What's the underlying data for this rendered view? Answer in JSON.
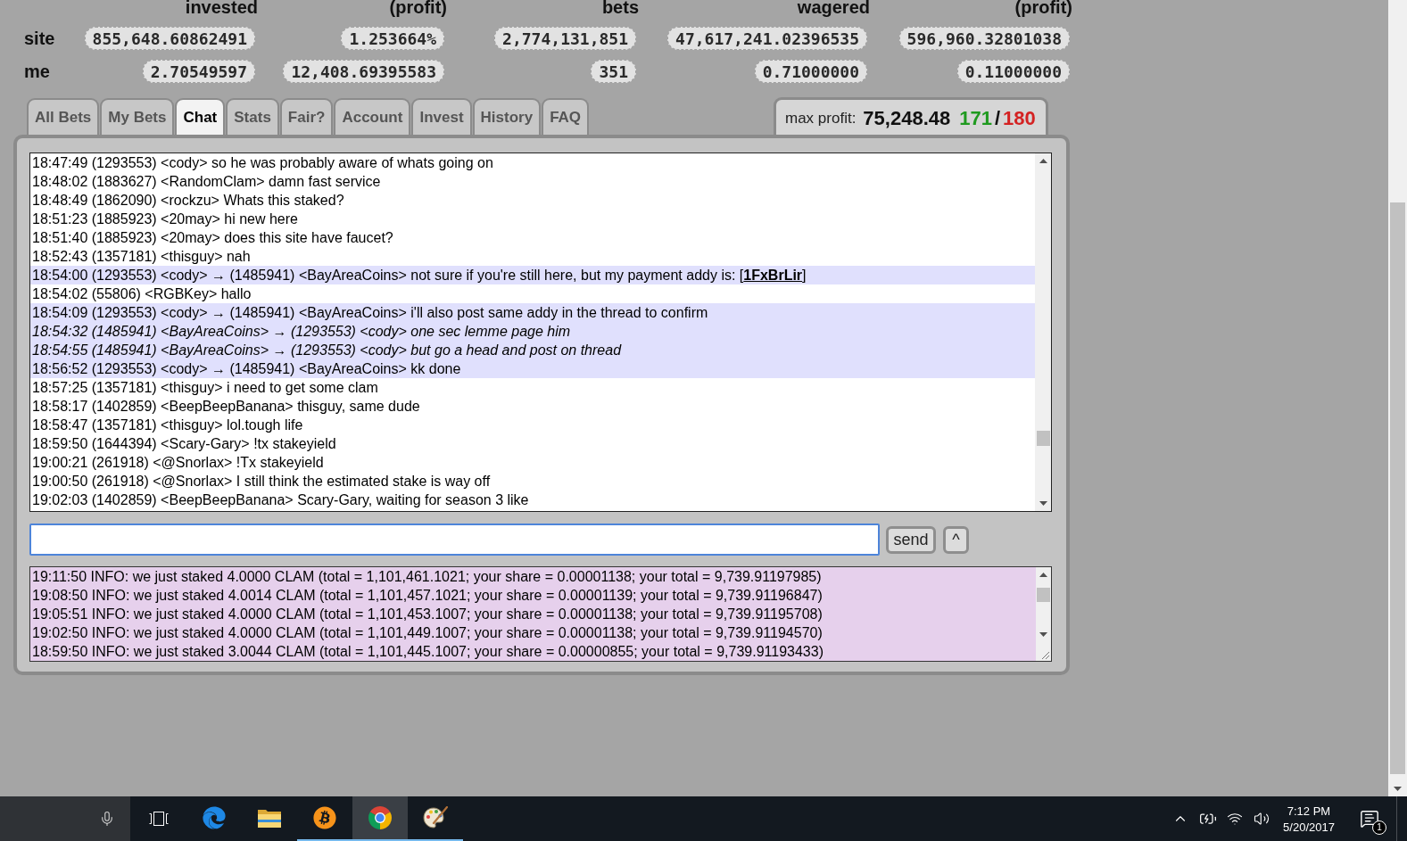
{
  "stats": {
    "columns": [
      "invested",
      "(profit)",
      "bets",
      "wagered",
      "(profit)"
    ],
    "rows": [
      {
        "label": "site",
        "values": [
          "855,648.60862491",
          "1.253664%",
          "2,774,131,851",
          "47,617,241.02396535",
          "596,960.32801038"
        ]
      },
      {
        "label": "me",
        "values": [
          "2.70549597",
          "12,408.69395583",
          "351",
          "0.71000000",
          "0.11000000"
        ]
      }
    ]
  },
  "tabs": [
    {
      "label": "All Bets",
      "selected": false
    },
    {
      "label": "My Bets",
      "selected": false
    },
    {
      "label": "Chat",
      "selected": true
    },
    {
      "label": "Stats",
      "selected": false
    },
    {
      "label": "Fair?",
      "selected": false
    },
    {
      "label": "Account",
      "selected": false
    },
    {
      "label": "Invest",
      "selected": false
    },
    {
      "label": "History",
      "selected": false
    },
    {
      "label": "FAQ",
      "selected": false
    }
  ],
  "max_profit": {
    "label": "max profit:",
    "value": "75,248.48",
    "counts": [
      {
        "value": "171",
        "color": "#1f9a1f"
      },
      {
        "value": "180",
        "color": "#d42222"
      }
    ],
    "separator": "/"
  },
  "chat": {
    "messages": [
      {
        "kind": "public",
        "text": "18:47:49 (1293553) <cody> so he was probably aware of whats going on"
      },
      {
        "kind": "public",
        "text": "18:48:02 (1883627) <RandomClam> damn fast service"
      },
      {
        "kind": "public",
        "text": "18:48:49 (1862090) <rockzu> Whats this staked?"
      },
      {
        "kind": "public",
        "text": "18:51:23 (1885923) <20may> hi new here"
      },
      {
        "kind": "public",
        "text": "18:51:40 (1885923) <20may> does this site have faucet?"
      },
      {
        "kind": "public",
        "text": "18:52:43 (1357181) <thisguy> nah"
      },
      {
        "kind": "private_sent",
        "text": "18:54:00 (1293553) <cody> → (1485941) <BayAreaCoins> not sure if you're still here, but my payment addy is: [",
        "link": "1FxBrLir",
        "text_after": "]"
      },
      {
        "kind": "public",
        "text": "18:54:02 (55806) <RGBKey> hallo"
      },
      {
        "kind": "private_sent",
        "text": "18:54:09 (1293553) <cody> → (1485941) <BayAreaCoins> i'll also post same addy in the thread to confirm"
      },
      {
        "kind": "private_received",
        "text": "18:54:32 (1485941) <BayAreaCoins> → (1293553) <cody> one sec lemme page him"
      },
      {
        "kind": "private_received",
        "text": "18:54:55 (1485941) <BayAreaCoins> → (1293553) <cody> but go a head and post on thread"
      },
      {
        "kind": "private_sent",
        "text": "18:56:52 (1293553) <cody> → (1485941) <BayAreaCoins> kk done"
      },
      {
        "kind": "public",
        "text": "18:57:25 (1357181) <thisguy> i need to get some clam"
      },
      {
        "kind": "public",
        "text": "18:58:17 (1402859) <BeepBeepBanana> thisguy, same dude"
      },
      {
        "kind": "public",
        "text": "18:58:47 (1357181) <thisguy> lol.tough life"
      },
      {
        "kind": "public",
        "text": "18:59:50 (1644394) <Scary-Gary> !tx stakeyield"
      },
      {
        "kind": "public",
        "text": "19:00:21 (261918) <@Snorlax> !Tx stakeyield"
      },
      {
        "kind": "public",
        "text": "19:00:50 (261918) <@Snorlax> I still think the estimated stake is way off"
      },
      {
        "kind": "public",
        "text": "19:02:03 (1402859) <BeepBeepBanana> Scary-Gary, waiting for season 3 like"
      }
    ],
    "input": {
      "focused": true
    },
    "buttons": [
      "send",
      "^"
    ]
  },
  "info_log": {
    "lines": [
      "19:11:50 INFO: we just staked 4.0000 CLAM (total = 1,101,461.1021; your share = 0.00001138; your total = 9,739.91197985)",
      "19:08:50 INFO: we just staked 4.0014 CLAM (total = 1,101,457.1021; your share = 0.00001139; your total = 9,739.91196847)",
      "19:05:51 INFO: we just staked 4.0000 CLAM (total = 1,101,453.1007; your share = 0.00001138; your total = 9,739.91195708)",
      "19:02:50 INFO: we just staked 4.0000 CLAM (total = 1,101,449.1007; your share = 0.00001138; your total = 9,739.91194570)",
      "18:59:50 INFO: we just staked 3.0044 CLAM (total = 1,101,445.1007; your share = 0.00000855; your total = 9,739.91193433)"
    ]
  },
  "taskbar": {
    "apps": [
      {
        "running": false,
        "active": false
      },
      {
        "running": false,
        "active": false
      },
      {
        "running": true,
        "active": false
      },
      {
        "running": true,
        "active": true
      },
      {
        "running": true,
        "active": false
      }
    ],
    "clock": {
      "time": "7:12 PM",
      "date": "5/20/2017"
    },
    "notification_count": "1"
  }
}
